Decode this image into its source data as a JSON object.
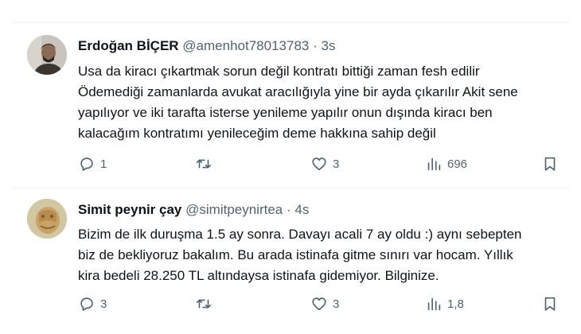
{
  "tweets": [
    {
      "name": "Erdoğan BİÇER",
      "handle": "@amenhot78013783",
      "separator": "·",
      "time": "3s",
      "lines": [
        "Usa da kiracı çıkartmak sorun değil kontratı bittiği zaman fesh edilir",
        "Ödemediği zamanlarda avukat aracılığıyla yine bir ayda çıkarılır Akit sene",
        "yapılıyor ve iki tarafta isterse yenileme yapılır onun dışında kiracı ben",
        "kalacağım kontratımı yenileceğim deme hakkına sahip değil"
      ],
      "replies": "1",
      "retweets": "",
      "likes": "3",
      "views": "696"
    },
    {
      "name": "Simit peynir çay",
      "handle": "@simitpeynirtea",
      "separator": "·",
      "time": "4s",
      "lines": [
        "Bizim de ilk duruşma 1.5 ay sonra. Davayı acali 7 ay oldu :) aynı sebepten",
        "biz de bekliyoruz bakalım. Bu arada istinafa gitme sınırı var hocam. Yıllık",
        "kira bedeli 28.250 TL altındaysa istinafa gidemiyor. Bilginize."
      ],
      "replies": "3",
      "retweets": "",
      "likes": "3",
      "views": "1,8"
    }
  ],
  "icons": {
    "reply": "reply-icon",
    "retweet": "retweet-icon",
    "like": "heart-icon",
    "views": "views-icon",
    "bookmark": "bookmark-icon"
  },
  "colors": {
    "text": "#0f1419",
    "secondary": "#536471",
    "divider": "#eff3f4",
    "background": "#ffffff"
  }
}
